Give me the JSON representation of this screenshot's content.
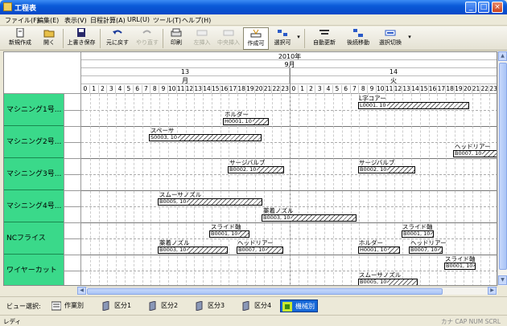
{
  "window": {
    "title": "工程表",
    "min": "_",
    "max": "□",
    "close": "×"
  },
  "menu": [
    "ファイル(F)",
    "編集(E)",
    "表示(V)",
    "日程計算(A)",
    "URL(U)",
    "ツール(T)",
    "ヘルプ(H)"
  ],
  "toolbar": {
    "new": "新規作成",
    "open": "開く",
    "save": "上書き保存",
    "undo": "元に戻す",
    "redo": "やり直す",
    "print": "印刷",
    "insert_left": "左挿入",
    "insert_mid": "中央挿入",
    "create": "作成可",
    "select": "選択可",
    "auto_update": "自動更新",
    "move_after": "後続移動",
    "toggle_select": "選択切換"
  },
  "header": {
    "year": "2010年",
    "month": "9月",
    "days": [
      {
        "day": "13",
        "dow": "月"
      },
      {
        "day": "14",
        "dow": "火"
      }
    ],
    "hours": [
      "0",
      "1",
      "2",
      "3",
      "4",
      "5",
      "6",
      "7",
      "8",
      "9",
      "10",
      "11",
      "12",
      "13",
      "14",
      "15",
      "16",
      "17",
      "18",
      "19",
      "20",
      "21",
      "22",
      "23",
      "0",
      "1",
      "2",
      "3",
      "4",
      "5",
      "6",
      "7",
      "8",
      "9",
      "10",
      "11",
      "12",
      "13",
      "14",
      "15",
      "16",
      "17",
      "18",
      "19",
      "20",
      "21",
      "22",
      "23"
    ]
  },
  "rows": [
    {
      "name": "マシニング1号..."
    },
    {
      "name": "マシニング2号..."
    },
    {
      "name": "マシニング3号..."
    },
    {
      "name": "マシニング4号..."
    },
    {
      "name": "NCフライス"
    },
    {
      "name": "ワイヤーカット"
    }
  ],
  "bars": [
    {
      "label": "L字コアー",
      "code": "L0001, 10"
    },
    {
      "label": "ホルダー",
      "code": "H0001, 10"
    },
    {
      "label": "スペーサ",
      "code": "S0003, 10"
    },
    {
      "label": "ヘッドリアー",
      "code": "B0007, 10"
    },
    {
      "label": "サージバルブ",
      "code": "B0002, 10"
    },
    {
      "label": "サージバルブ",
      "code": "B0002, 10"
    },
    {
      "label": "スムーサノズル",
      "code": "B0005, 10"
    },
    {
      "label": "薬着ノズル",
      "code": "B0003, 10"
    },
    {
      "label": "スライド軸",
      "code": "B0001, 10"
    },
    {
      "label": "スライド軸",
      "code": "B0001, 10"
    },
    {
      "label": "薬着ノズル",
      "code": "B0003, 10"
    },
    {
      "label": "ヘッドリアー",
      "code": "B0007, 10"
    },
    {
      "label": "ホルダー",
      "code": "H0001, 10"
    },
    {
      "label": "ヘッドリアー",
      "code": "B0007, 10"
    },
    {
      "label": "スライド軸",
      "code": "B0001, 10"
    },
    {
      "label": "スムーサノズル",
      "code": "B0005, 10"
    }
  ],
  "viewbar": {
    "label": "ビュー選択:",
    "items": [
      "作業別",
      "区分1",
      "区分2",
      "区分3",
      "区分4",
      "機械別"
    ],
    "selected": "機械別"
  },
  "status": {
    "left": "レディ",
    "right": "カナ CAP NUM SCRL"
  },
  "colors": {
    "row_bg": "#3ad98a",
    "title": "#0a5ad8",
    "selected_view": "#1668d8"
  }
}
